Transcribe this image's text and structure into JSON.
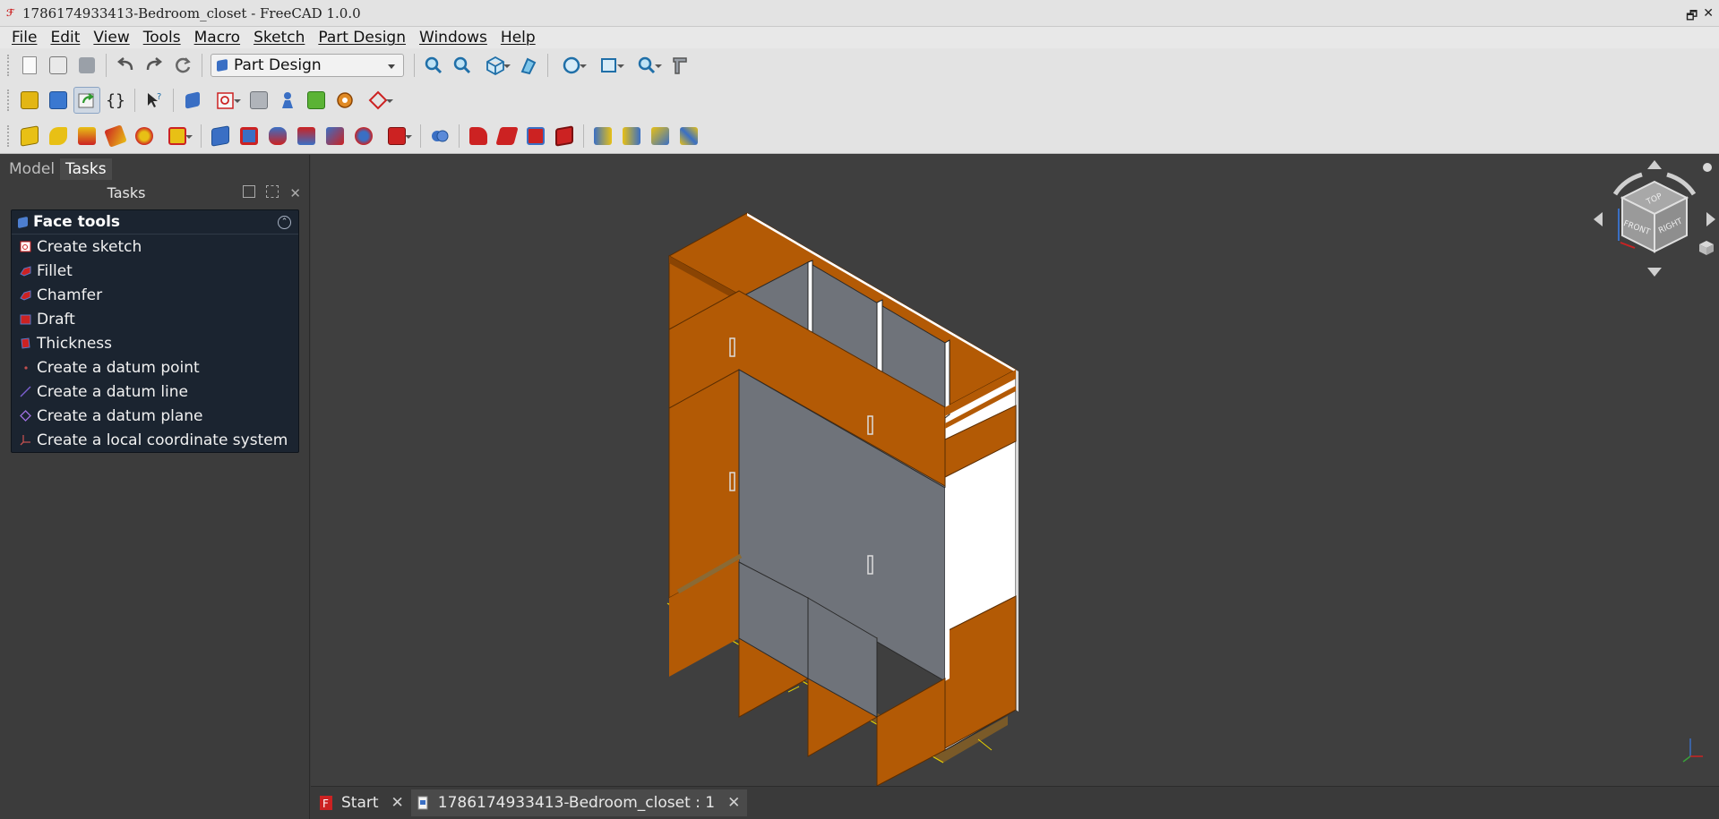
{
  "window": {
    "title": "1786174933413-Bedroom_closet - FreeCAD 1.0.0",
    "restore_label": "🗗",
    "close_label": "✕"
  },
  "menu": [
    "File",
    "Edit",
    "View",
    "Tools",
    "Macro",
    "Sketch",
    "Part Design",
    "Windows",
    "Help"
  ],
  "toolbar": {
    "workbench": "Part Design",
    "macro_braces": "{}"
  },
  "panel": {
    "tabs": [
      "Model",
      "Tasks"
    ],
    "active_tab": "Tasks",
    "header": "Tasks",
    "task_box": {
      "title": "Face tools",
      "collapse_symbol": "⌃",
      "items": [
        {
          "label": "Create sketch",
          "icon": "sketch-icon"
        },
        {
          "label": "Fillet",
          "icon": "fillet-icon"
        },
        {
          "label": "Chamfer",
          "icon": "chamfer-icon"
        },
        {
          "label": "Draft",
          "icon": "draft-icon"
        },
        {
          "label": "Thickness",
          "icon": "thickness-icon"
        },
        {
          "label": "Create a datum point",
          "icon": "datum-point-icon"
        },
        {
          "label": "Create a datum line",
          "icon": "datum-line-icon"
        },
        {
          "label": "Create a datum plane",
          "icon": "datum-plane-icon"
        },
        {
          "label": "Create a local coordinate system",
          "icon": "local-cs-icon"
        }
      ]
    }
  },
  "navcube": {
    "top": "TOP",
    "front": "FRONT",
    "right": "RIGHT"
  },
  "doc_tabs": [
    {
      "label": "Start",
      "close": "✕"
    },
    {
      "label": "1786174933413-Bedroom_closet : 1",
      "close": "✕"
    }
  ],
  "colors": {
    "wood": "#b35a05",
    "wood_dark": "#8a4403",
    "back_panel": "#6f737a",
    "base": "#8a6a35",
    "selected_white": "#ffffff",
    "task_box_bg": "#1b2430",
    "view_bg": "#3f3f3f"
  }
}
